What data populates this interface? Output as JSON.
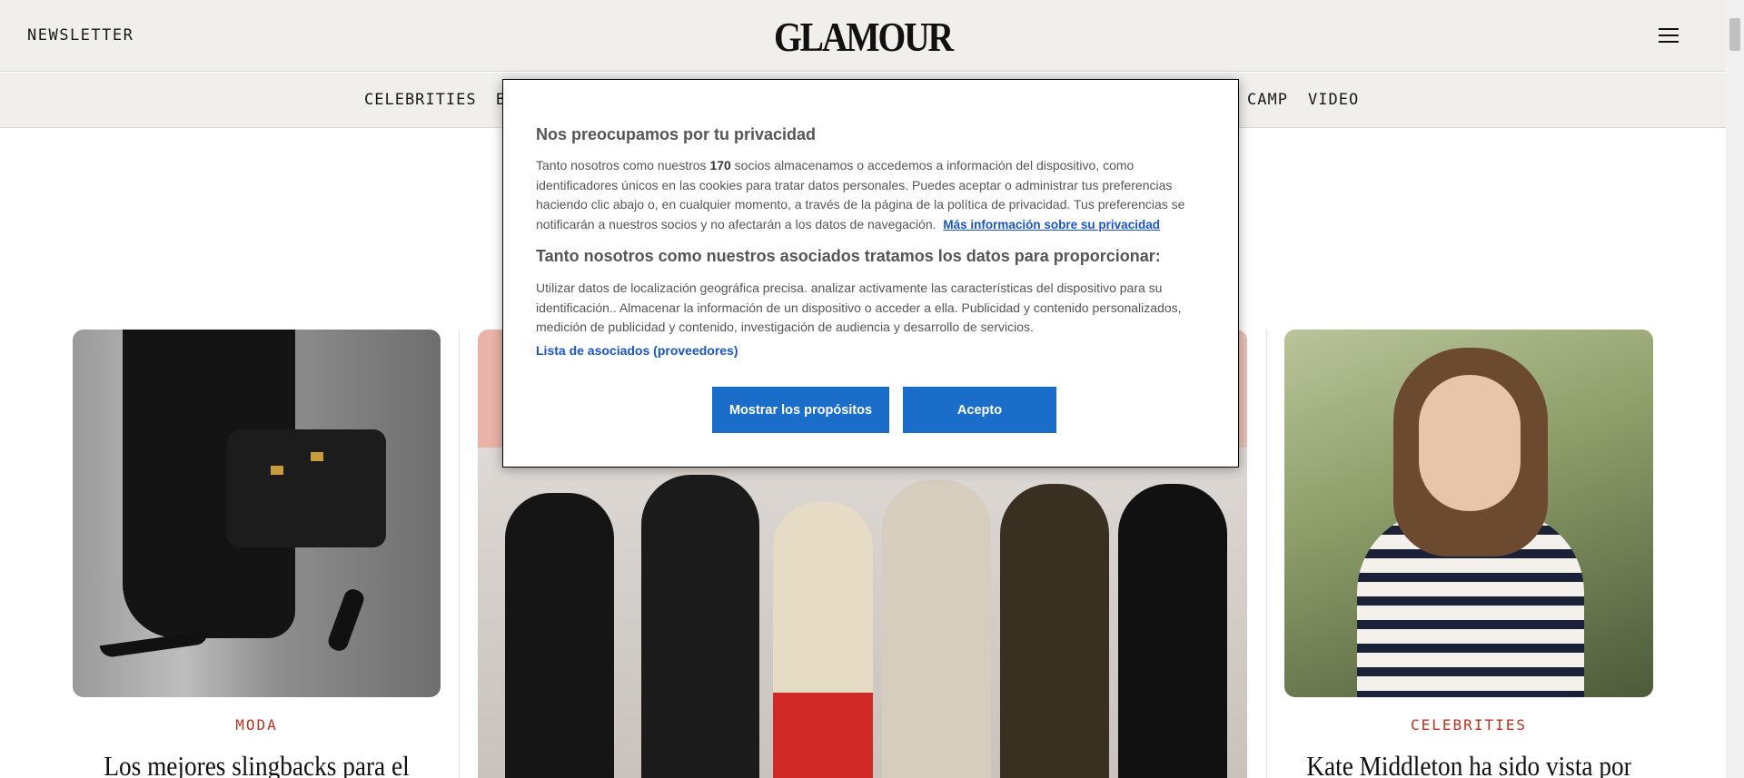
{
  "header": {
    "newsletter_label": "NEWSLETTER",
    "logo_text": "GLAMOUR"
  },
  "nav": {
    "items": [
      "CELEBRITIES",
      "B",
      "CAMP",
      "VIDEO"
    ]
  },
  "cards": [
    {
      "category": "MODA",
      "title": "Los mejores slingbacks para el"
    },
    {
      "category": "",
      "title": ""
    },
    {
      "category": "CELEBRITIES",
      "title": "Kate Middleton ha sido vista por ahí"
    }
  ],
  "consent": {
    "title": "Nos preocupamos por tu privacidad",
    "para1_before": "Tanto nosotros como nuestros ",
    "partners_count": "170",
    "para1_after": " socios almacenamos o accedemos a información del dispositivo, como identificadores únicos en las cookies para tratar datos personales. Puedes aceptar o administrar tus preferencias haciendo clic abajo o, en cualquier momento, a través de la página de la política de privacidad. Tus preferencias se notificarán a nuestros socios y no afectarán a los datos de navegación.",
    "privacy_link": "Más información sobre su privacidad",
    "subtitle": "Tanto nosotros como nuestros asociados tratamos los datos para proporcionar:",
    "para2": "Utilizar datos de localización geográfica precisa. analizar activamente las características del dispositivo para su identificación.. Almacenar la información de un dispositivo o acceder a ella. Publicidad y contenido personalizados, medición de publicidad y contenido, investigación de audiencia y desarrollo de servicios.",
    "vendors_link": "Lista de asociados (proveedores)",
    "purposes_button": "Mostrar los propósitos",
    "accept_button": "Acepto"
  },
  "colors": {
    "header_bg": "#f1efeb",
    "category_red": "#b8321f",
    "button_blue": "#1a6ec9",
    "link_blue": "#1a55c4"
  }
}
